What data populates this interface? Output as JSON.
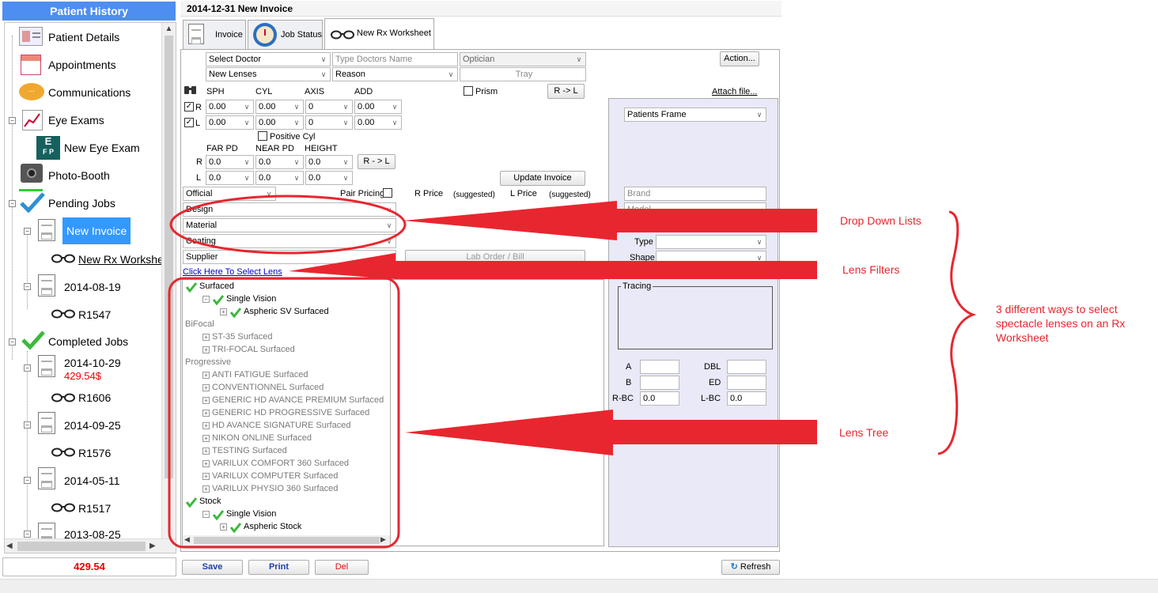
{
  "sidebar": {
    "title": "Patient History",
    "items": [
      {
        "label": "Patient Details"
      },
      {
        "label": "Appointments"
      },
      {
        "label": "Communications"
      },
      {
        "label": "Eye Exams"
      },
      {
        "label": "New Eye Exam"
      },
      {
        "label": "Photo-Booth"
      },
      {
        "label": "Pending Jobs"
      },
      {
        "label": "New Invoice"
      },
      {
        "label": "New Rx Workshe"
      },
      {
        "label": "2014-08-19"
      },
      {
        "label": "R1547"
      },
      {
        "label": "Completed Jobs"
      },
      {
        "label": "2014-10-29",
        "amount": "429.54$"
      },
      {
        "label": "R1606"
      },
      {
        "label": "2014-09-25"
      },
      {
        "label": "R1576"
      },
      {
        "label": "2014-05-11"
      },
      {
        "label": "R1517"
      },
      {
        "label": "2013-08-25"
      }
    ],
    "total": "429.54",
    "eye_exam_icon_letters": [
      "E",
      "F",
      "P"
    ]
  },
  "header": {
    "title": "2014-12-31 New Invoice"
  },
  "tabs": [
    {
      "label": "Invoice"
    },
    {
      "label": "Job Status"
    },
    {
      "label": "New Rx Worksheet",
      "active": true
    }
  ],
  "form": {
    "select_doctor": "Select Doctor",
    "type_doctors_name": "Type Doctors Name",
    "optician": "Optician",
    "action_button": "Action...",
    "new_lenses": "New Lenses",
    "reason": "Reason",
    "tray": "Tray",
    "prism": "Prism",
    "r_to_l": "R -> L",
    "attach_file": "Attach file...",
    "rx_headers": [
      "SPH",
      "CYL",
      "AXIS",
      "ADD"
    ],
    "row_r": "R",
    "row_l": "L",
    "rx_r": [
      "0.00",
      "0.00",
      "0",
      "0.00"
    ],
    "rx_l": [
      "0.00",
      "0.00",
      "0",
      "0.00"
    ],
    "positive_cyl": "Positive Cyl",
    "pd_headers": [
      "FAR PD",
      "NEAR PD",
      "HEIGHT"
    ],
    "pd_r": [
      "0.0",
      "0.0",
      "0.0"
    ],
    "pd_l": [
      "0.0",
      "0.0",
      "0.0"
    ],
    "r_to_l_2": "R - > L",
    "update_invoice": "Update Invoice",
    "official": "Official",
    "pair_pricing": "Pair Pricing",
    "r_price": "R Price",
    "suggested_1": "(suggested)",
    "l_price": "L Price",
    "suggested_2": "(suggested)",
    "design": "Design",
    "material": "Material",
    "coating": "Coating",
    "supplier": "Supplier",
    "lab_order": "Lab Order / Bill",
    "click_here": "Click Here To Select Lens"
  },
  "frame_panel": {
    "patients_frame": "Patients Frame",
    "brand": "Brand",
    "model": "Model",
    "type_label": "Type",
    "shape_label": "Shape",
    "tracing": "Tracing",
    "a": "A",
    "b": "B",
    "dbl": "DBL",
    "ed": "ED",
    "r_bc": "R-BC",
    "r_bc_value": "0.0",
    "l_bc": "L-BC",
    "l_bc_value": "0.0"
  },
  "lens_tree": [
    {
      "label": "Surfaced",
      "level": 0,
      "checked": true
    },
    {
      "label": "Single Vision",
      "level": 1,
      "checked": true
    },
    {
      "label": "Aspheric SV Surfaced",
      "level": 2,
      "checked": true
    },
    {
      "label": "BiFocal",
      "level": 0,
      "dim": true
    },
    {
      "label": "ST-35 Surfaced",
      "level": 1,
      "dim": true
    },
    {
      "label": "TRI-FOCAL Surfaced",
      "level": 1,
      "dim": true
    },
    {
      "label": "Progressive",
      "level": 0,
      "dim": true
    },
    {
      "label": "ANTI FATIGUE Surfaced",
      "level": 1,
      "dim": true
    },
    {
      "label": "CONVENTIONNEL Surfaced",
      "level": 1,
      "dim": true
    },
    {
      "label": "GENERIC HD AVANCE PREMIUM Surfaced",
      "level": 1,
      "dim": true
    },
    {
      "label": "GENERIC HD PROGRESSIVE Surfaced",
      "level": 1,
      "dim": true
    },
    {
      "label": "HD AVANCE SIGNATURE Surfaced",
      "level": 1,
      "dim": true
    },
    {
      "label": "NIKON ONLINE Surfaced",
      "level": 1,
      "dim": true
    },
    {
      "label": "TESTING Surfaced",
      "level": 1,
      "dim": true
    },
    {
      "label": "VARILUX COMFORT 360 Surfaced",
      "level": 1,
      "dim": true
    },
    {
      "label": "VARILUX COMPUTER Surfaced",
      "level": 1,
      "dim": true
    },
    {
      "label": "VARILUX PHYSIO 360 Surfaced",
      "level": 1,
      "dim": true
    },
    {
      "label": "Stock",
      "level": 0,
      "checked": true
    },
    {
      "label": "Single Vision",
      "level": 1,
      "checked": true
    },
    {
      "label": "Aspheric Stock",
      "level": 2,
      "checked": true
    }
  ],
  "footer": {
    "save": "Save",
    "print": "Print",
    "del": "Del",
    "refresh": "Refresh"
  },
  "annotations": {
    "dropdown_lists": "Drop Down Lists",
    "lens_filters": "Lens Filters",
    "lens_tree": "Lens Tree",
    "note": "3 different ways to select spectacle lenses on an Rx Worksheet"
  },
  "colors": {
    "sidebar_header": "#4e8ef0",
    "selected_item": "#3399ff",
    "annotation_red": "#e8262f",
    "frame_panel_bg": "#e9e9f7"
  }
}
